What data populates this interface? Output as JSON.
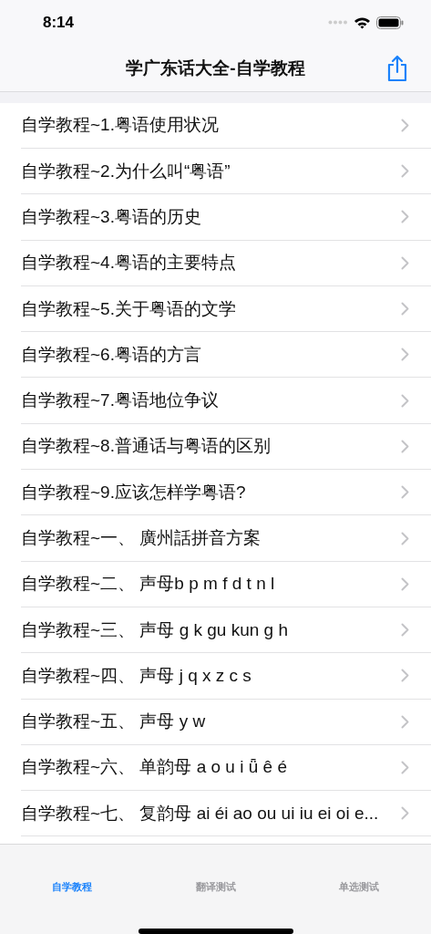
{
  "status_bar": {
    "time": "8:14"
  },
  "nav": {
    "title": "学广东话大全-自学教程"
  },
  "list": [
    {
      "label": "自学教程~1.粤语使用状况"
    },
    {
      "label": "自学教程~2.为什么叫“粤语”"
    },
    {
      "label": "自学教程~3.粤语的历史"
    },
    {
      "label": "自学教程~4.粤语的主要特点"
    },
    {
      "label": "自学教程~5.关于粤语的文学"
    },
    {
      "label": "自学教程~6.粤语的方言"
    },
    {
      "label": "自学教程~7.粤语地位争议"
    },
    {
      "label": "自学教程~8.普通话与粤语的区别"
    },
    {
      "label": "自学教程~9.应该怎样学粤语?"
    },
    {
      "label": "自学教程~一、 廣州話拼音方案"
    },
    {
      "label": "自学教程~二、 声母b p m f d t n l"
    },
    {
      "label": "自学教程~三、 声母 g k gu kun g h"
    },
    {
      "label": "自学教程~四、 声母 j q x z c s"
    },
    {
      "label": "自学教程~五、 声母 y w"
    },
    {
      "label": "自学教程~六、 单韵母 a o u i ǖ ê é"
    },
    {
      "label": "自学教程~七、 复韵母 ai éi ao ou ui iu ei oi e..."
    }
  ],
  "tabs": [
    {
      "label": "自学教程",
      "selected": true
    },
    {
      "label": "翻译测试",
      "selected": false
    },
    {
      "label": "单选测试",
      "selected": false
    }
  ]
}
